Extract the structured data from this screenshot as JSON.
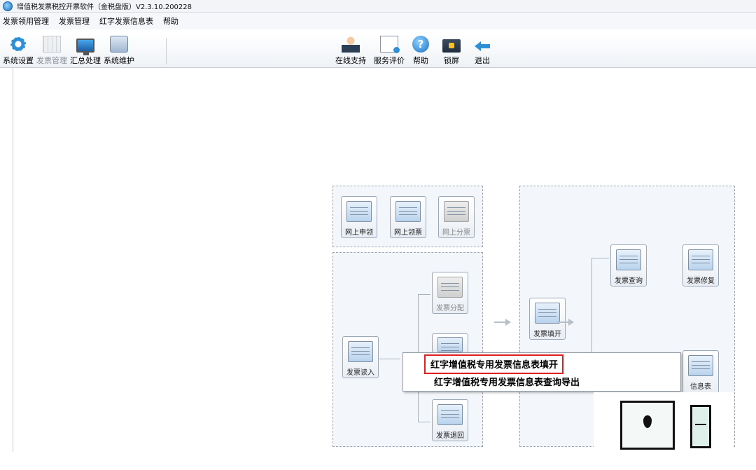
{
  "window": {
    "title": "增值税发票税控开票软件（金税盘版）V2.3.10.200228"
  },
  "menubar": {
    "items": [
      "发票领用管理",
      "发票管理",
      "红字发票信息表",
      "帮助"
    ]
  },
  "toolbar": {
    "left": [
      {
        "label": "系统设置",
        "icon": "gear-icon"
      },
      {
        "label": "发票管理",
        "icon": "invoice-grid-icon",
        "disabled": true
      },
      {
        "label": "汇总处理",
        "icon": "monitor-icon"
      },
      {
        "label": "系统维护",
        "icon": "folder-icon"
      }
    ],
    "right": [
      {
        "label": "在线支持",
        "icon": "person-icon"
      },
      {
        "label": "服务评价",
        "icon": "document-icon"
      },
      {
        "label": "帮助",
        "icon": "help-icon",
        "glyph": "?"
      },
      {
        "label": "锁屏",
        "icon": "lock-screen-icon"
      },
      {
        "label": "退出",
        "icon": "exit-arrow-icon"
      }
    ]
  },
  "flow": {
    "top_panel": [
      {
        "label": "网上申领"
      },
      {
        "label": "网上领票"
      },
      {
        "label": "网上分票",
        "disabled": true
      }
    ],
    "left_panel": {
      "read": "发票读入",
      "distribute": "发票分配",
      "return": "发票退回"
    },
    "right_panel": {
      "issue": "发票填开",
      "query": "发票查询",
      "repair": "发票修复",
      "info_table": "信息表"
    }
  },
  "context_menu": {
    "items": [
      {
        "label": "红字增值税专用发票信息表填开",
        "highlighted": true
      },
      {
        "label": "红字增值税专用发票信息表查询导出"
      }
    ]
  },
  "colors": {
    "highlight_border": "#e02020",
    "accent": "#2f8fd6",
    "panel_bg": "#f3f6fa"
  }
}
